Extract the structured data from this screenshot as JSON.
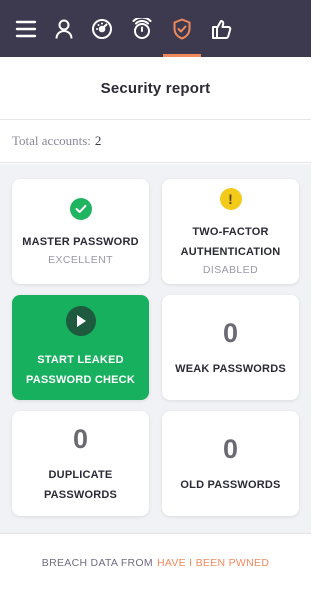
{
  "nav": {
    "icons": [
      "menu-icon",
      "user-icon",
      "dashboard-icon",
      "timer-icon",
      "shield-check-icon",
      "thumbs-up-icon"
    ],
    "active": "shield-check-icon",
    "accent_color": "#f08a5d",
    "bar_color": "#3d3a50"
  },
  "page": {
    "title": "Security report"
  },
  "summary": {
    "total_label": "Total accounts:",
    "total_value": "2"
  },
  "cards": {
    "master_password": {
      "title": "MASTER PASSWORD",
      "status": "EXCELLENT",
      "icon": "check-circle-icon"
    },
    "two_factor": {
      "title_line1": "TWO-FACTOR",
      "title_line2": "AUTHENTICATION",
      "status": "DISABLED",
      "icon": "warning-icon",
      "icon_glyph": "!"
    },
    "leak_check": {
      "title_line1": "START LEAKED",
      "title_line2": "PASSWORD CHECK",
      "icon": "play-icon",
      "color": "#17b05f"
    },
    "weak": {
      "count": "0",
      "title": "WEAK PASSWORDS"
    },
    "duplicate": {
      "count": "0",
      "title_line1": "DUPLICATE",
      "title_line2": "PASSWORDS"
    },
    "old": {
      "count": "0",
      "title": "OLD PASSWORDS"
    }
  },
  "footer": {
    "prefix": "BREACH DATA FROM",
    "link": "HAVE I BEEN PWNED"
  }
}
